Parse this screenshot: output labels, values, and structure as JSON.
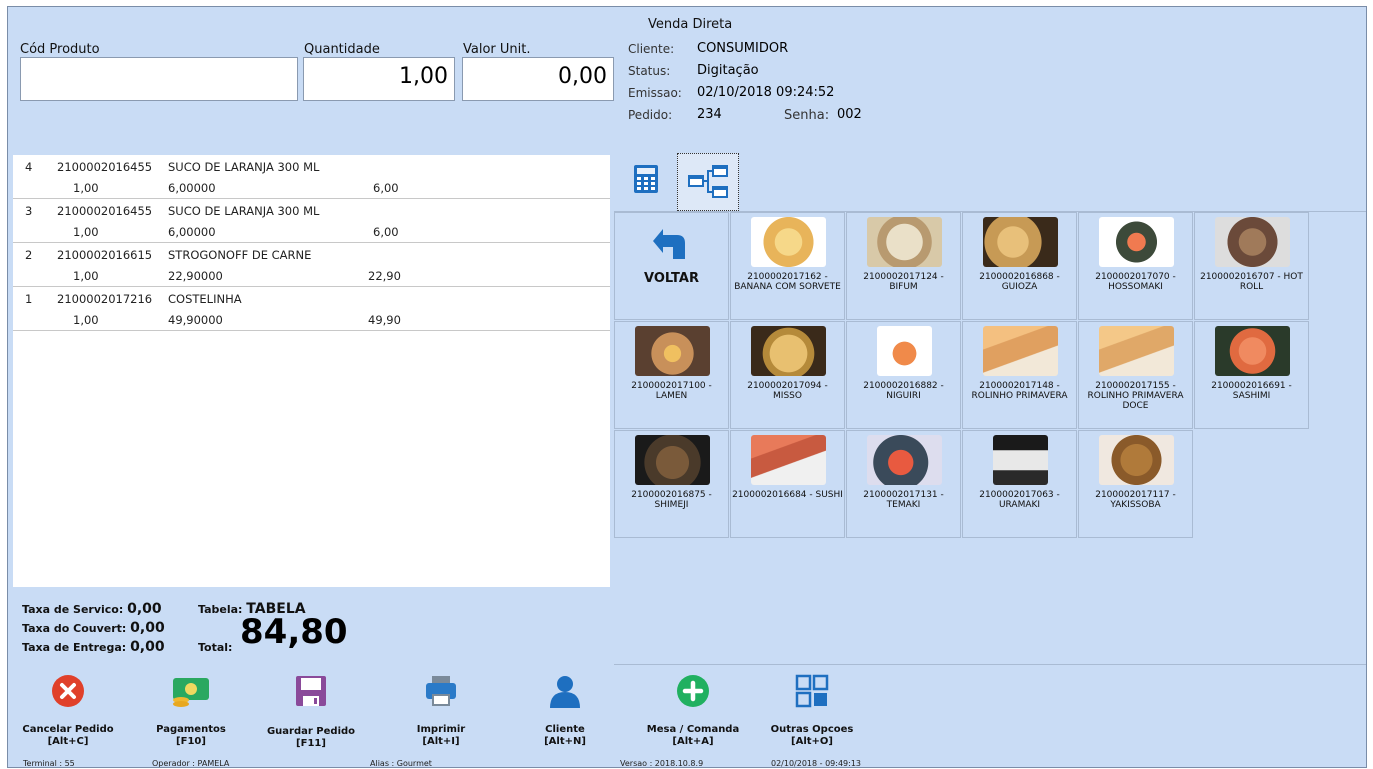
{
  "window": {
    "title": "Venda Direta"
  },
  "entry": {
    "cod_label": "Cód Produto",
    "cod_value": "",
    "qty_label": "Quantidade",
    "qty_value": "1,00",
    "price_label": "Valor Unit.",
    "price_value": "0,00"
  },
  "info": {
    "cliente_label": "Cliente:",
    "cliente_value": "CONSUMIDOR",
    "status_label": "Status:",
    "status_value": "Digitação",
    "emissao_label": "Emissao:",
    "emissao_value": "02/10/2018 09:24:52",
    "pedido_label": "Pedido:",
    "pedido_value": "234",
    "senha_label": "Senha:",
    "senha_value": "002"
  },
  "items": [
    {
      "seq": "4",
      "code": "2100002016455",
      "name": "SUCO DE LARANJA 300 ML",
      "qty": "1,00",
      "unit": "6,00000",
      "total": "6,00"
    },
    {
      "seq": "3",
      "code": "2100002016455",
      "name": "SUCO DE LARANJA 300 ML",
      "qty": "1,00",
      "unit": "6,00000",
      "total": "6,00"
    },
    {
      "seq": "2",
      "code": "2100002016615",
      "name": "STROGONOFF DE CARNE",
      "qty": "1,00",
      "unit": "22,90000",
      "total": "22,90"
    },
    {
      "seq": "1",
      "code": "2100002017216",
      "name": "COSTELINHA",
      "qty": "1,00",
      "unit": "49,90000",
      "total": "49,90"
    }
  ],
  "totals": {
    "servico_label": "Taxa de Servico:",
    "servico_value": "0,00",
    "couvert_label": "Taxa do Couvert:",
    "couvert_value": "0,00",
    "entrega_label": "Taxa de Entrega:",
    "entrega_value": "0,00",
    "tabela_label": "Tabela:",
    "tabela_value": "TABELA",
    "total_label": "Total:",
    "total_value": "84,80"
  },
  "grid": {
    "voltar_label": "VOLTAR",
    "products": [
      {
        "label": "2100002017162 - BANANA COM SORVETE",
        "color": "#e8b45a"
      },
      {
        "label": "2100002017124 - BIFUM",
        "color": "#d8c9a8"
      },
      {
        "label": "2100002016868 - GUIOZA",
        "color": "#c79a55"
      },
      {
        "label": "2100002017070 - HOSSOMAKI",
        "color": "#3d4a3a"
      },
      {
        "label": "2100002016707 - HOT ROLL",
        "color": "#6b4a3a"
      },
      {
        "label": "2100002017100 - LAMEN",
        "color": "#5a4030"
      },
      {
        "label": "2100002017094 - MISSO",
        "color": "#b58a3a"
      },
      {
        "label": "2100002016882 - NIGUIRI",
        "color": "#f08a4a"
      },
      {
        "label": "2100002017148 - ROLINHO PRIMAVERA",
        "color": "#e0a060"
      },
      {
        "label": "2100002017155 - ROLINHO PRIMAVERA DOCE",
        "color": "#e0a868"
      },
      {
        "label": "2100002016691 - SASHIMI",
        "color": "#e06a40"
      },
      {
        "label": "2100002016875 - SHIMEJI",
        "color": "#4a3a2a"
      },
      {
        "label": "2100002016684 - SUSHI",
        "color": "#c85a40"
      },
      {
        "label": "2100002017131 - TEMAKI",
        "color": "#3a4a5a"
      },
      {
        "label": "2100002017063 - URAMAKI",
        "color": "#2a2a2a"
      },
      {
        "label": "2100002017117 - YAKISSOBA",
        "color": "#8a5a2a"
      }
    ]
  },
  "toolbar": {
    "cancelar": "Cancelar Pedido",
    "cancelar_key": "[Alt+C]",
    "pagamentos": "Pagamentos",
    "pagamentos_key": "[F10]",
    "guardar": "Guardar Pedido",
    "guardar_key": "[F11]",
    "imprimir": "Imprimir",
    "imprimir_key": "[Alt+I]",
    "cliente": "Cliente",
    "cliente_key": "[Alt+N]",
    "mesa": "Mesa / Comanda",
    "mesa_key": "[Alt+A]",
    "outras": "Outras Opcoes",
    "outras_key": "[Alt+O]"
  },
  "statusbar": {
    "terminal": "Terminal : 55",
    "operador": "Operador : PAMELA",
    "alias": "Alias : Gourmet",
    "versao": "Versao : 2018.10.8.9",
    "datetime": "02/10/2018 - 09:49:13"
  },
  "colors": {
    "accent_blue": "#1e6fc0",
    "cancel_red": "#e0402a",
    "add_green": "#20b060",
    "save_purple": "#8a4a9a"
  }
}
